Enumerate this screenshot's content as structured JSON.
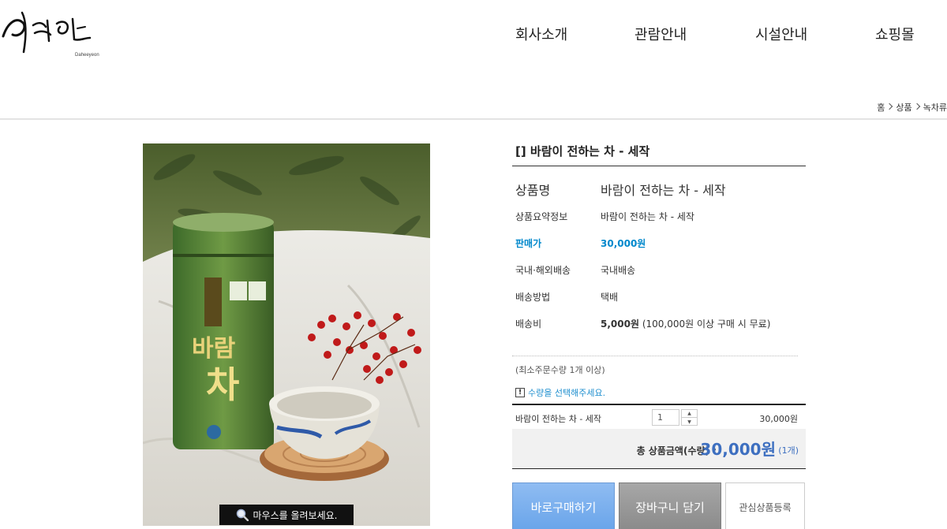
{
  "header": {
    "logo_text": "다희연",
    "logo_sub": "Daheeyeon",
    "nav": [
      "회사소개",
      "관람안내",
      "시설안내",
      "쇼핑몰"
    ]
  },
  "breadcrumb": [
    "홈",
    "상품",
    "녹차류"
  ],
  "image": {
    "zoom_text": "마우스를 올려보세요."
  },
  "product": {
    "title": "[] 바람이 전하는 차 - 세작",
    "rows": [
      {
        "label": "상품명",
        "value": "바람이 전하는 차 - 세작"
      },
      {
        "label": "상품요약정보",
        "value": "바람이 전하는 차 - 세작"
      },
      {
        "label": "판매가",
        "value": "30,000원"
      },
      {
        "label": "국내·해외배송",
        "value": "국내배송"
      },
      {
        "label": "배송방법",
        "value": "택배"
      },
      {
        "label": "배송비",
        "value": "5,000원",
        "note": "(100,000원 이상 구매 시 무료)"
      }
    ],
    "min_order": "(최소주문수량 1개 이상)",
    "select_notice": "수량을 선택해주세요.",
    "option": {
      "name": "바람이 전하는 차 - 세작",
      "qty": "1",
      "price": "30,000원"
    },
    "total": {
      "label": "총 상품금액(수량) :",
      "value": "30,000원",
      "count": "(1개)"
    },
    "buttons": {
      "buy": "바로구매하기",
      "cart": "장바구니 담기",
      "wish": "관심상품등록"
    }
  },
  "colors": {
    "price_blue": "#0088cc",
    "total_blue": "#3d6fc0",
    "buy_button": "#7fb1ee",
    "cart_button": "#999999"
  }
}
